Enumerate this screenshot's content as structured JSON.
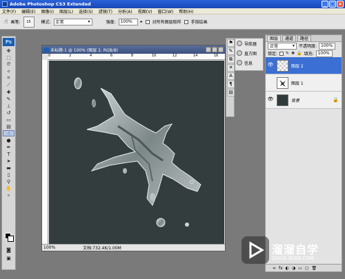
{
  "app": {
    "title": "Adobe Photoshop CS3 Extended"
  },
  "menu": [
    "文件(F)",
    "编辑(E)",
    "图像(I)",
    "图层(L)",
    "选择(S)",
    "滤镜(T)",
    "分析(A)",
    "视图(V)",
    "窗口(W)",
    "帮助(H)"
  ],
  "options": {
    "brush_label": "画笔:",
    "brush_size": "15",
    "mode_label": "模式:",
    "mode_value": "正常",
    "strength_label": "强度:",
    "strength_value": "100%",
    "all_layers_label": "对所有图层取样",
    "finger_label": "手指绘画"
  },
  "document": {
    "title": "未标题-1 @ 100% (图层 2, RGB/8)",
    "zoom": "100%",
    "doc_info": "文档:732.4K/1.00M",
    "ruler_ticks": [
      "0",
      "2",
      "4",
      "6",
      "8",
      "10",
      "12",
      "14",
      "16"
    ],
    "canvas_color": "#333d3d"
  },
  "nav_panel": {
    "items": [
      "导航器",
      "直方图",
      "信息"
    ]
  },
  "layers_panel": {
    "tabs": [
      "图层",
      "通道",
      "路径"
    ],
    "blend_mode": "正常",
    "opacity_label": "不透明度:",
    "opacity_value": "100%",
    "lock_label": "锁定:",
    "fill_label": "填充:",
    "fill_value": "100%",
    "layers": [
      {
        "name": "图层 2",
        "selected": true
      },
      {
        "name": "图层 1",
        "selected": false
      },
      {
        "name": "背景",
        "selected": false
      }
    ]
  },
  "watermark": {
    "title": "溜溜自学",
    "url": "ZIXUE.3D66.COM"
  }
}
